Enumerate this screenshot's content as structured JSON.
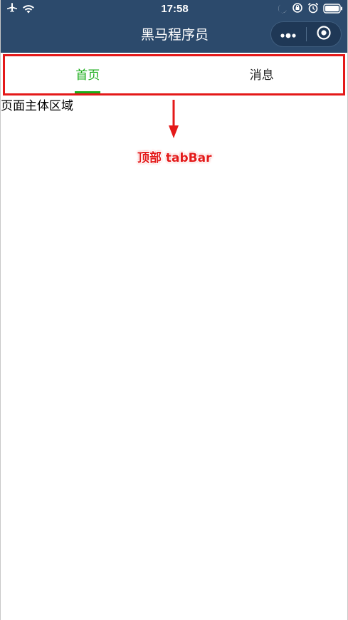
{
  "status_bar": {
    "time": "17:58",
    "left_icons": [
      "airplane-icon",
      "wifi-icon"
    ],
    "right_icons": [
      "moon-icon",
      "orientation-lock-icon",
      "alarm-icon",
      "battery-icon"
    ]
  },
  "nav_bar": {
    "title": "黑马程序员",
    "capsule": {
      "more_icon": "more-dots-icon",
      "close_icon": "target-circle-icon"
    }
  },
  "tabbar": {
    "tabs": [
      {
        "label": "首页",
        "active": true
      },
      {
        "label": "消息",
        "active": false
      }
    ]
  },
  "main": {
    "text": "页面主体区域"
  },
  "annotation": {
    "label": "顶部 tabBar"
  },
  "colors": {
    "nav_background": "#2c4a6c",
    "tab_active": "#1aad19",
    "annotation_red": "#e41919"
  }
}
